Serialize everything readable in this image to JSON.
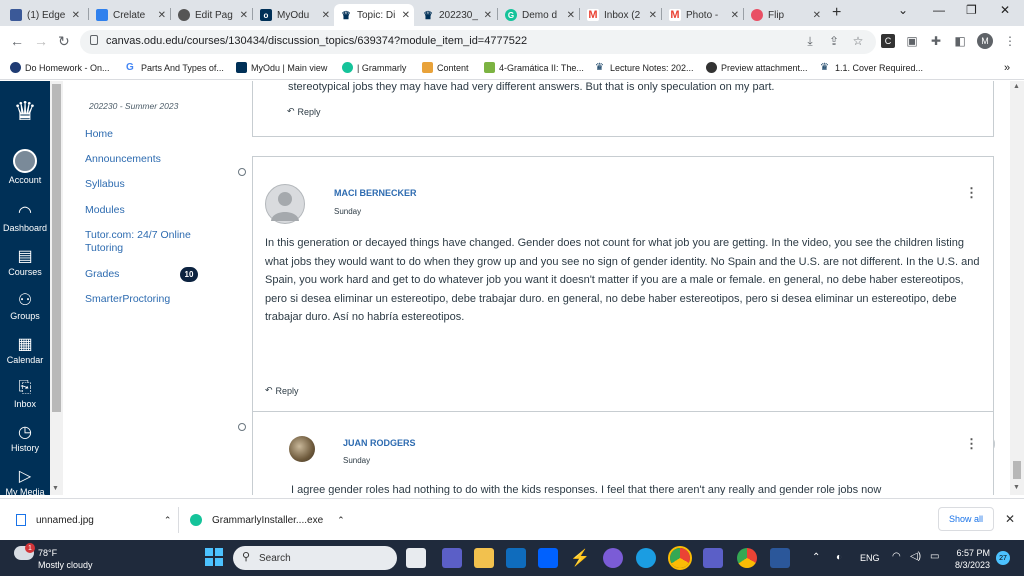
{
  "browser": {
    "tabs": [
      {
        "label": "(1) Edge",
        "color": "#3b5998"
      },
      {
        "label": "Crelate",
        "color": "#2f80ed"
      },
      {
        "label": "Edit Pag",
        "color": "#555555"
      },
      {
        "label": "MyOdu",
        "color": "#003057"
      },
      {
        "label": "Topic: Di",
        "color": "#003057",
        "active": true
      },
      {
        "label": "202230_",
        "color": "#003057"
      },
      {
        "label": "Demo d",
        "color": "#15c39a"
      },
      {
        "label": "Inbox (2",
        "color": "#ea4335"
      },
      {
        "label": "Photo -",
        "color": "#ea4335"
      },
      {
        "label": "Flip",
        "color": "#e94f64"
      }
    ],
    "url": "canvas.odu.edu/courses/130434/discussion_topics/639374?module_item_id=4777522",
    "profile_initial": "M",
    "bookmarks": [
      "Do Homework - On...",
      "Parts And Types of...",
      "MyOdu | Main view",
      "| Grammarly",
      "Content",
      "4-Gramática II: The...",
      "Lecture Notes: 202...",
      "Preview attachment...",
      "1.1. Cover Required..."
    ]
  },
  "global_nav": [
    {
      "label": "Account"
    },
    {
      "label": "Dashboard"
    },
    {
      "label": "Courses"
    },
    {
      "label": "Groups"
    },
    {
      "label": "Calendar"
    },
    {
      "label": "Inbox"
    },
    {
      "label": "History"
    },
    {
      "label": "My Media"
    }
  ],
  "course_nav": {
    "term": "202230 - Summer 2023",
    "items": [
      "Home",
      "Announcements",
      "Syllabus",
      "Modules",
      "Tutor.com: 24/7 Online Tutoring",
      "Grades",
      "SmarterProctoring"
    ],
    "grades_badge": "10"
  },
  "discussion": {
    "prev_tail": "stereotypical jobs they may have had very different answers. But that is only speculation on my part.",
    "reply_label": "Reply",
    "post1": {
      "author": "MACI BERNECKER",
      "date": "Sunday",
      "body": "In this generation or decayed things have changed. Gender does not count for what job you are getting. In the video, you see the children listing what jobs they would want to do when they grow up and you see no sign of gender identity. No Spain and the U.S.  are not different. In the U.S. and Spain, you work hard and get to do whatever job you want it doesn't matter if you are a male or female. en general, no debe haber estereotipos, pero si desea eliminar un estereotipo, debe trabajar duro. en general, no debe haber estereotipos, pero si desea eliminar un estereotipo, debe trabajar duro. Así no habría estereotipos."
    },
    "post2": {
      "author": "JUAN RODGERS",
      "date": "Sunday",
      "body": "I agree gender roles had nothing to do with the kids responses. I feel that there aren't any really and gender role jobs now"
    }
  },
  "downloads": {
    "items": [
      "unnamed.jpg",
      "GrammarlyInstaller....exe"
    ],
    "show_all": "Show all"
  },
  "taskbar": {
    "temp": "78°F",
    "weather": "Mostly cloudy",
    "weather_badge": "1",
    "search_placeholder": "Search",
    "lang": "ENG",
    "time": "6:57 PM",
    "date": "8/3/2023",
    "notifications": "27"
  }
}
